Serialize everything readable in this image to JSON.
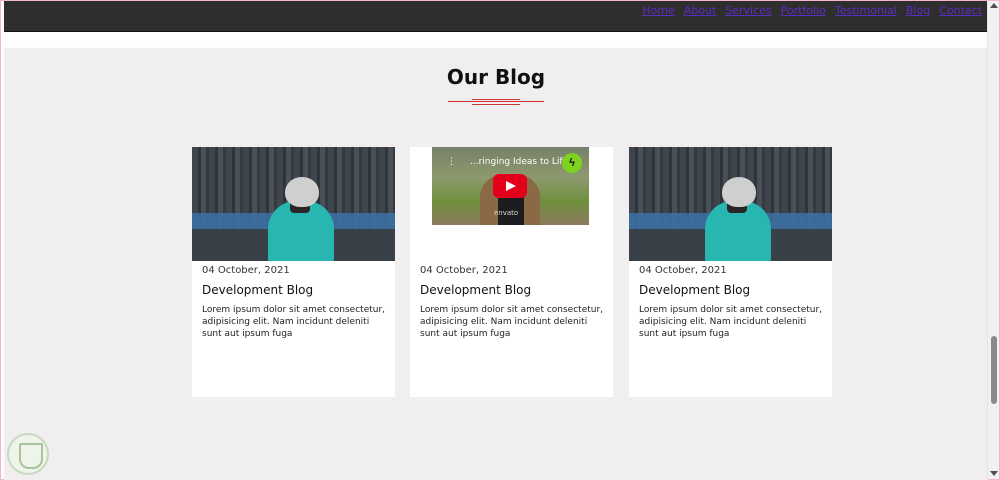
{
  "nav": {
    "items": [
      "Home",
      "About",
      "Services",
      "Portfolio",
      "Testimonial",
      "Blog",
      "Contact"
    ]
  },
  "section": {
    "title": "Our Blog"
  },
  "cards": [
    {
      "media": "photo",
      "date": "04 October, 2021",
      "title": "Development Blog",
      "text": "Lorem ipsum dolor sit amet consectetur, adipisicing elit. Nam incidunt deleniti sunt aut ipsum fuga"
    },
    {
      "media": "video",
      "video_title": "...ringing Ideas to Life",
      "video_brand": "envato",
      "date": "04 October, 2021",
      "title": "Development Blog",
      "text": "Lorem ipsum dolor sit amet consectetur, adipisicing elit. Nam incidunt deleniti sunt aut ipsum fuga"
    },
    {
      "media": "photo",
      "date": "04 October, 2021",
      "title": "Development Blog",
      "text": "Lorem ipsum dolor sit amet consectetur, adipisicing elit. Nam incidunt deleniti sunt aut ipsum fuga"
    }
  ],
  "colors": {
    "navbar": "#2e2e2e",
    "nav_link": "#5a2ec0",
    "section_bg": "#f0eeee",
    "accent": "#d42a2a",
    "coat": "#27b6b0",
    "youtube_red": "#e3001b"
  },
  "icons": {
    "video_menu": "more-vert-icon",
    "video_logo": "envato-leaf-icon",
    "video_play": "youtube-play-icon",
    "watermark": "shield-badge-icon"
  }
}
